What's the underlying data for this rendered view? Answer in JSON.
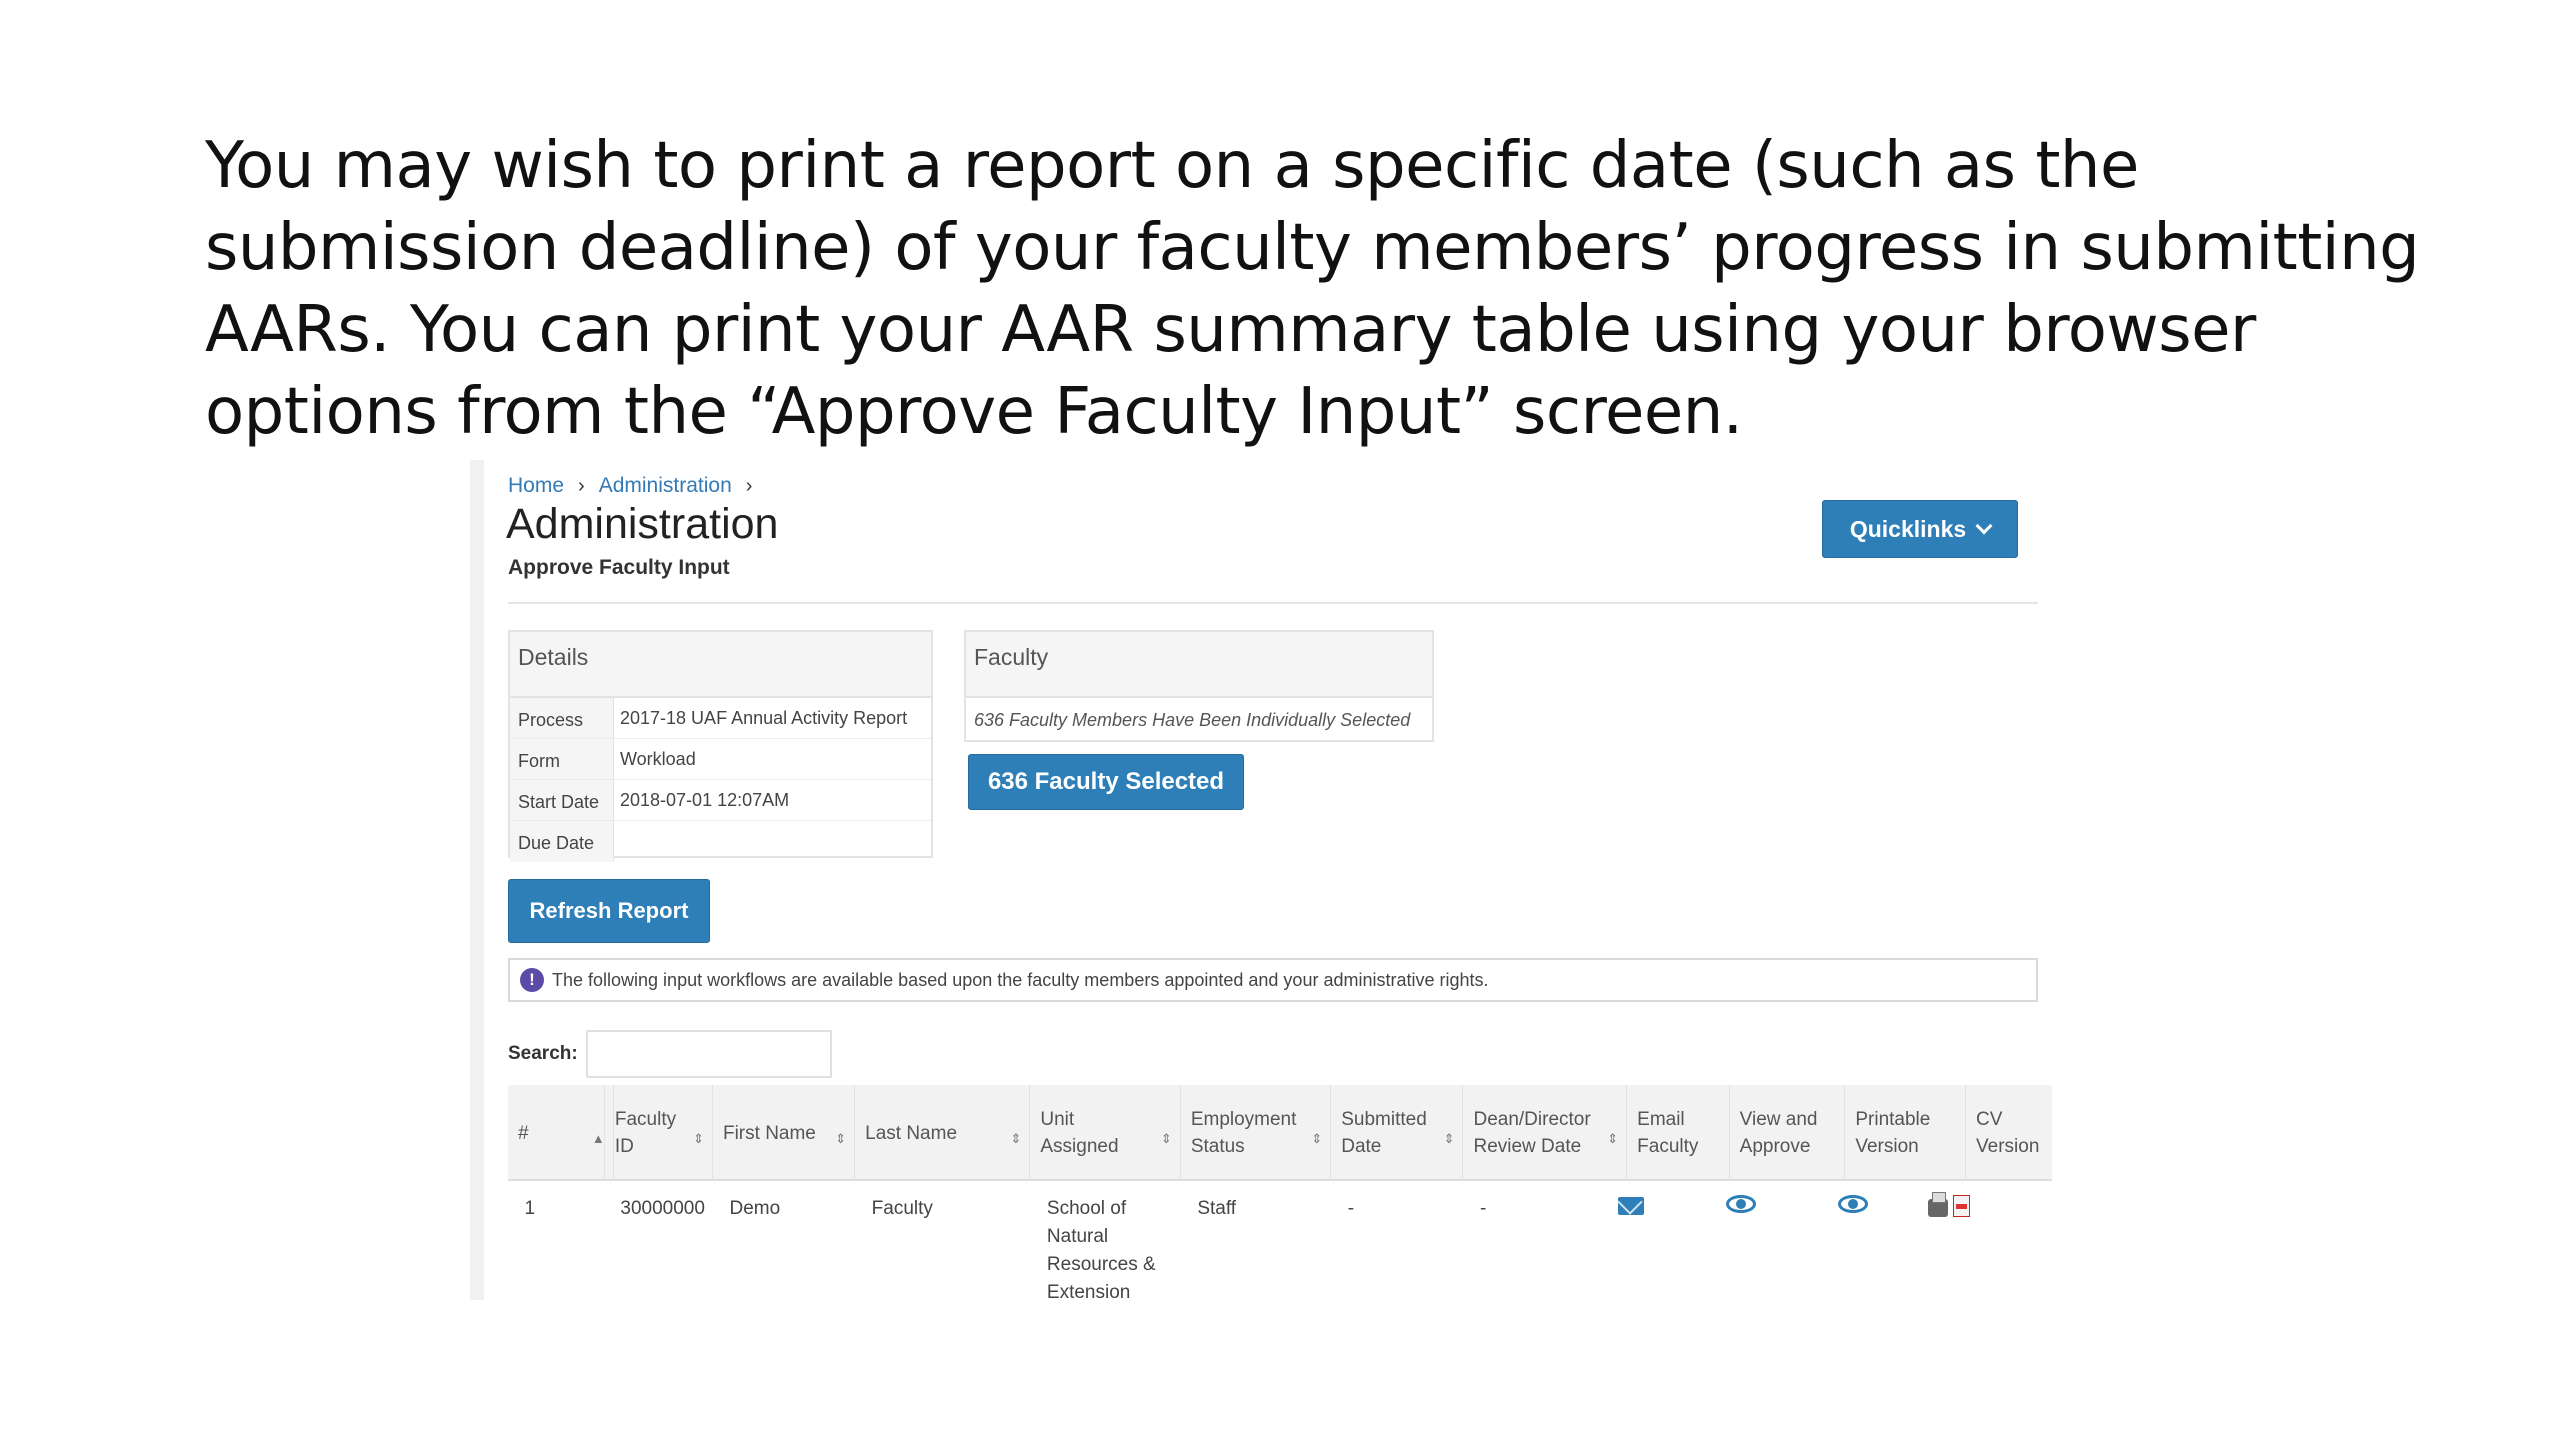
{
  "slide": {
    "text": "You may wish to print a report on a specific date (such as the submission deadline) of your faculty members’ progress in submitting AARs.  You can print your AAR summary table using your browser options from the “Approve Faculty Input” screen."
  },
  "breadcrumb": {
    "home": "Home",
    "admin": "Administration"
  },
  "page": {
    "title": "Administration",
    "subtitle": "Approve Faculty Input"
  },
  "quicklinks": {
    "label": "Quicklinks"
  },
  "details": {
    "heading": "Details",
    "rows": [
      {
        "key": "Process",
        "value": "2017-18 UAF Annual Activity Report"
      },
      {
        "key": "Form",
        "value": "Workload"
      },
      {
        "key": "Start Date",
        "value": "2018-07-01 12:07AM"
      },
      {
        "key": "Due Date",
        "value": ""
      }
    ]
  },
  "faculty": {
    "heading": "Faculty",
    "note": "636 Faculty Members Have Been Individually Selected",
    "button": "636 Faculty Selected"
  },
  "refresh": {
    "label": "Refresh Report"
  },
  "info": {
    "icon": "!",
    "text": "The following input workflows are available based upon the faculty members appointed and your administrative rights."
  },
  "search": {
    "label": "Search:",
    "placeholder": ""
  },
  "table": {
    "headers": [
      "#",
      "Faculty ID",
      "First Name",
      "Last Name",
      "Unit Assigned",
      "Employment Status",
      "Submitted Date",
      "Dean/Director Review Date",
      "Email Faculty",
      "View and Approve",
      "Printable Version",
      "CV Version"
    ],
    "rows": [
      {
        "num": "1",
        "id": "30000000",
        "first": "Demo",
        "last": "Faculty",
        "unit": "School of Natural Resources & Extension",
        "status": "Staff",
        "submitted": "-",
        "review": "-"
      }
    ]
  },
  "colors": {
    "accent": "#2e7fb8",
    "info": "#5b4aa6"
  }
}
